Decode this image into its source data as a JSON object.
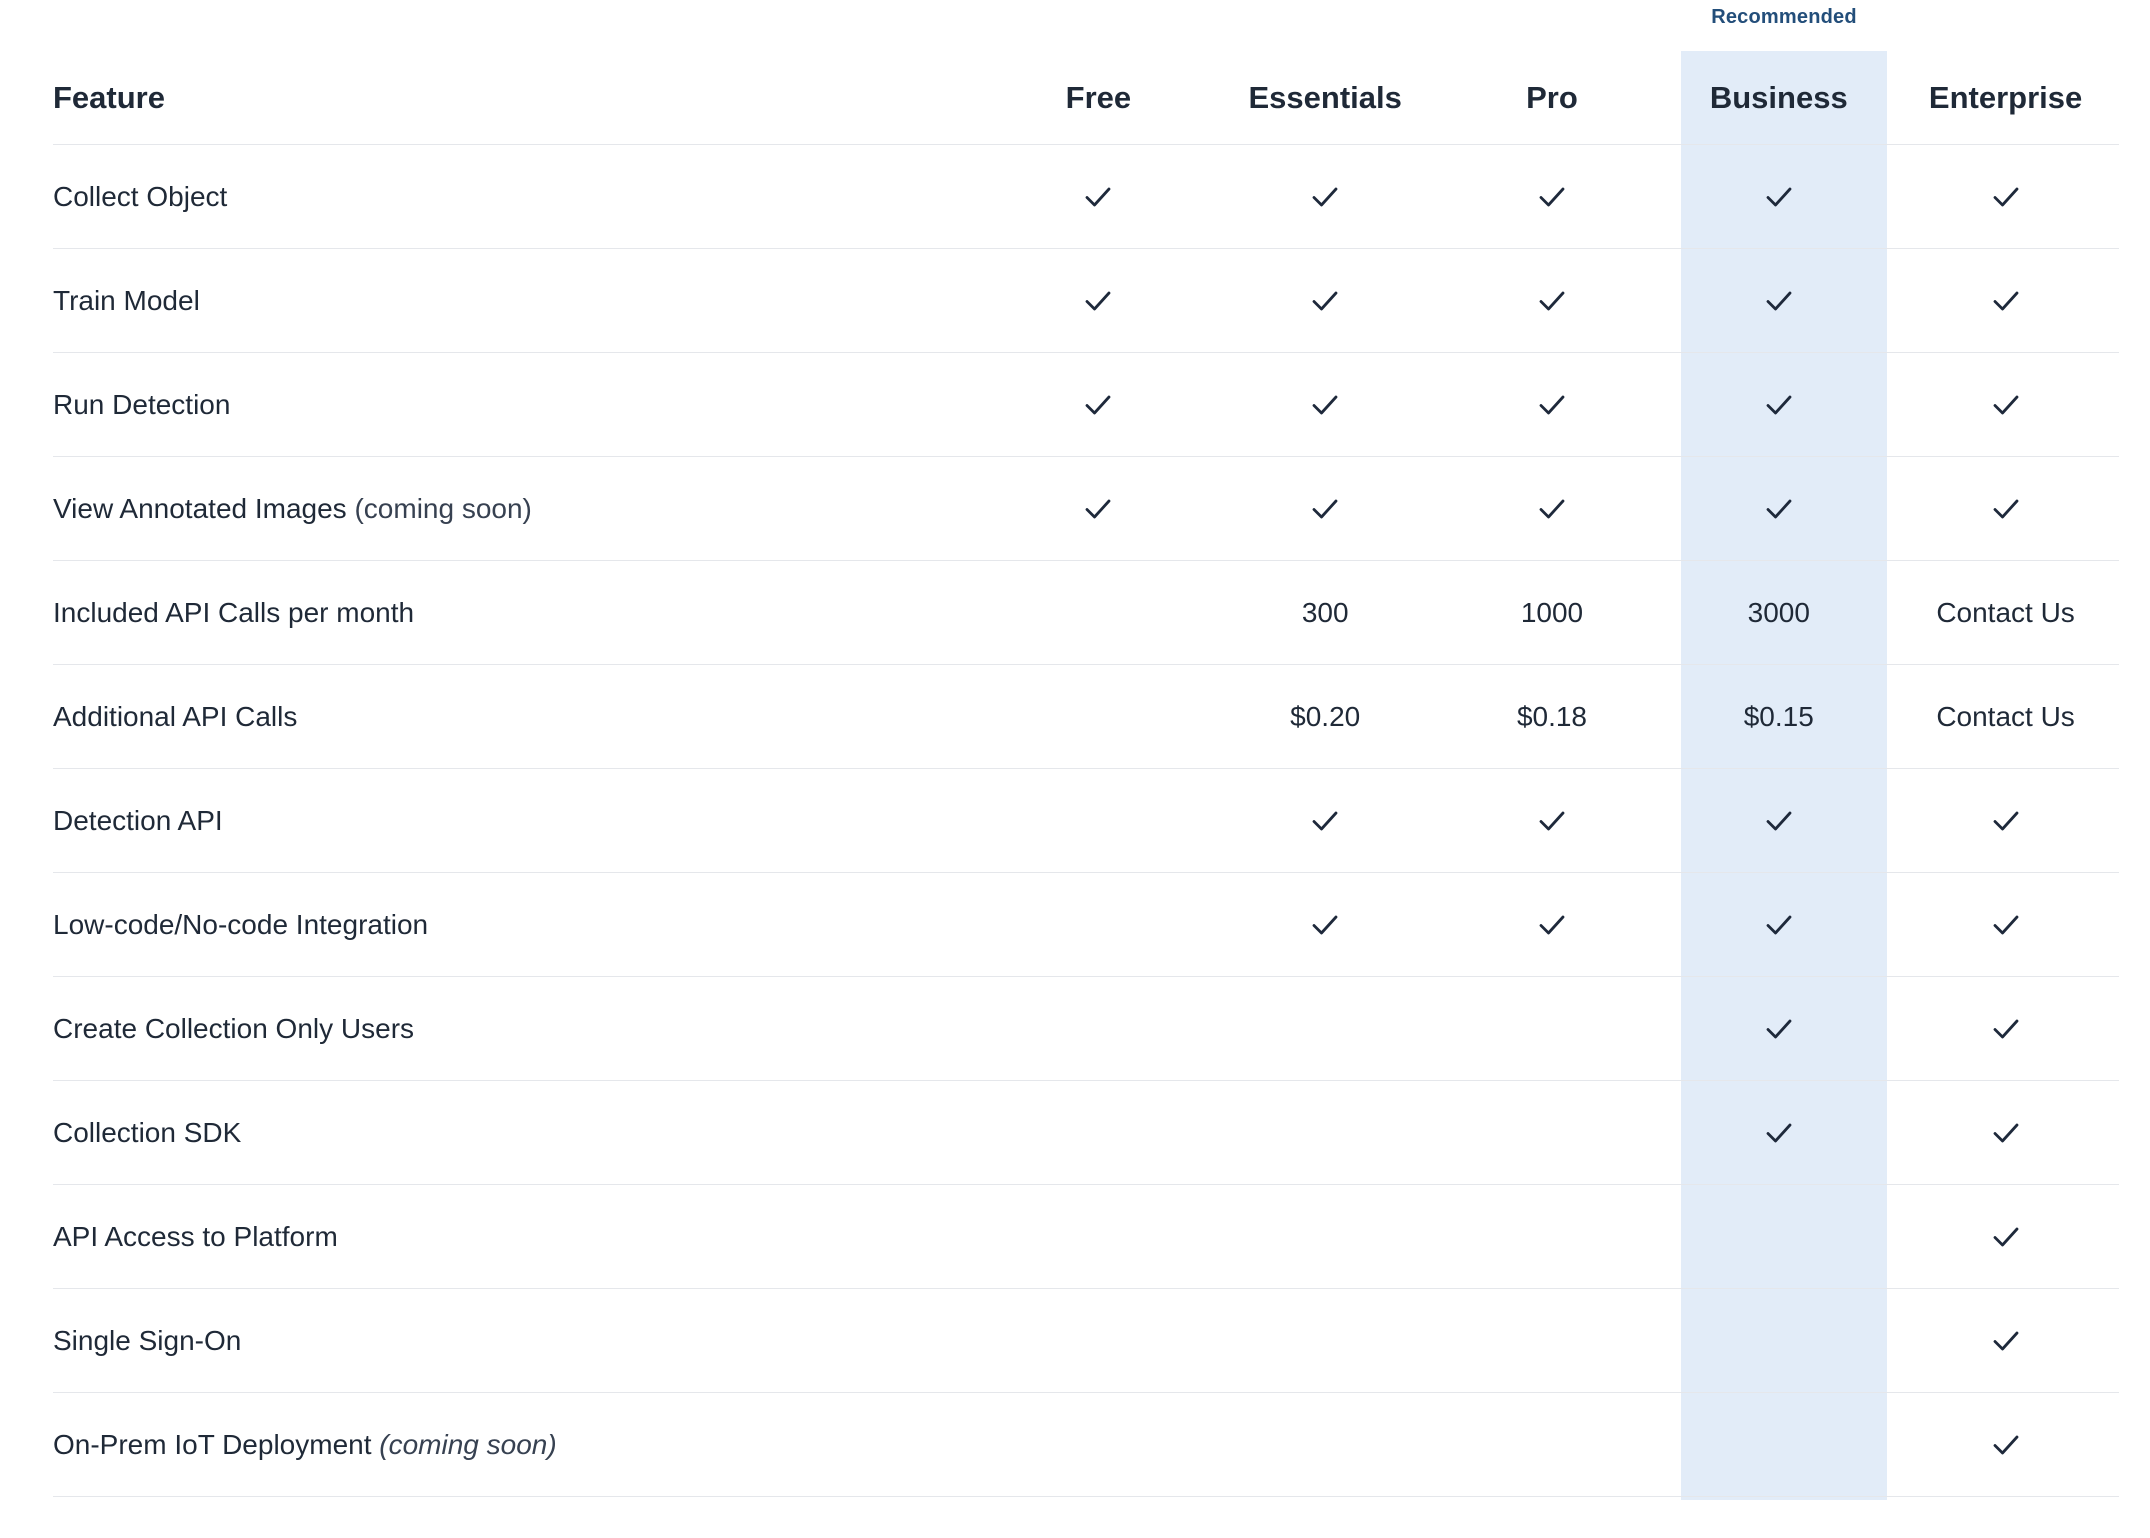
{
  "badge": {
    "recommended": "Recommended"
  },
  "header": {
    "feature": "Feature",
    "plans": [
      "Free",
      "Essentials",
      "Pro",
      "Business",
      "Enterprise"
    ]
  },
  "rows": [
    {
      "feature": "Collect Object",
      "note": "",
      "cells": [
        "check",
        "check",
        "check",
        "check",
        "check"
      ]
    },
    {
      "feature": "Train Model",
      "note": "",
      "cells": [
        "check",
        "check",
        "check",
        "check",
        "check"
      ]
    },
    {
      "feature": "Run Detection",
      "note": "",
      "cells": [
        "check",
        "check",
        "check",
        "check",
        "check"
      ]
    },
    {
      "feature": "View Annotated Images",
      "note": "(coming soon)",
      "note_italic": false,
      "cells": [
        "check",
        "check",
        "check",
        "check",
        "check"
      ]
    },
    {
      "feature": "Included API Calls per month",
      "note": "",
      "cells": [
        "",
        "300",
        "1000",
        "3000",
        "Contact Us"
      ]
    },
    {
      "feature": "Additional API Calls",
      "note": "",
      "cells": [
        "",
        "$0.20",
        "$0.18",
        "$0.15",
        "Contact Us"
      ]
    },
    {
      "feature": "Detection API",
      "note": "",
      "cells": [
        "",
        "check",
        "check",
        "check",
        "check"
      ]
    },
    {
      "feature": "Low-code/No-code Integration",
      "note": "",
      "cells": [
        "",
        "check",
        "check",
        "check",
        "check"
      ]
    },
    {
      "feature": "Create Collection Only Users",
      "note": "",
      "cells": [
        "",
        "",
        "",
        "check",
        "check"
      ]
    },
    {
      "feature": "Collection SDK",
      "note": "",
      "cells": [
        "",
        "",
        "",
        "check",
        "check"
      ]
    },
    {
      "feature": "API Access to Platform",
      "note": "",
      "cells": [
        "",
        "",
        "",
        "",
        "check"
      ]
    },
    {
      "feature": "Single Sign-On",
      "note": "",
      "cells": [
        "",
        "",
        "",
        "",
        "check"
      ]
    },
    {
      "feature": "On-Prem IoT Deployment",
      "note": "(coming soon)",
      "note_italic": true,
      "cells": [
        "",
        "",
        "",
        "",
        "check"
      ]
    }
  ],
  "colors": {
    "highlight": "#e2ecf8",
    "badge_text": "#234e7a",
    "check": "#1e293b",
    "divider": "#e5e7eb"
  },
  "icons": {
    "check": "check-icon"
  }
}
